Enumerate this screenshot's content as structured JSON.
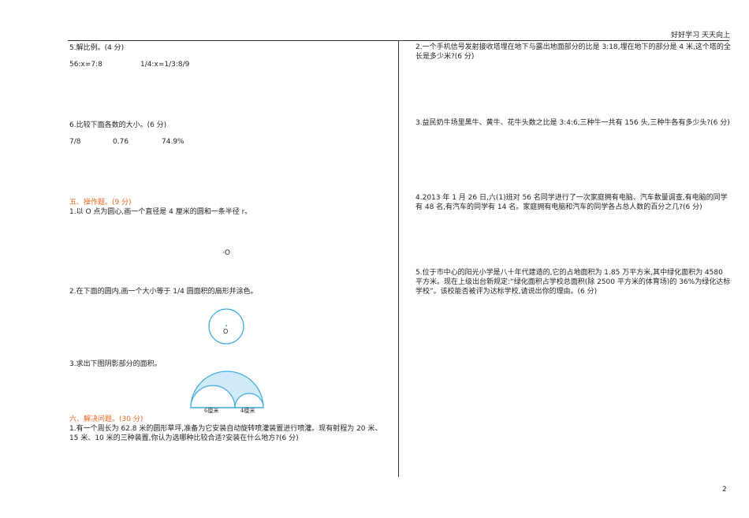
{
  "header": {
    "slogan": "好好学习 天天向上"
  },
  "page_number": "2",
  "left": {
    "q5": {
      "title": "5.解比例。(4 分)",
      "eq1": "56:x=7:8",
      "eq2": "1/4:x=1/3:8/9"
    },
    "q6": {
      "title": "6.比较下面各数的大小。(6 分)",
      "n1": "7/8",
      "n2": "0.76",
      "n3": "74.9%"
    },
    "section5": {
      "title": "五、操作题。(9 分)",
      "q1": "1.以 O 点为圆心,画一个直径是 4 厘米的圆和一条半径 r。",
      "point_label": "·O",
      "q2": "2.在下面的圆内,画一个大小等于 1/4 圆面积的扇形并涂色。",
      "circle_label": "O",
      "q3": "3.求出下图阴影部分的面积。",
      "fig_label1": "6厘米",
      "fig_label2": "4厘米"
    },
    "section6": {
      "title": "六、解决问题。(30 分)",
      "q1": "1.有一个周长为 62.8 米的圆形草坪,准备为它安装自动旋转喷灌装置进行喷灌。现有射程为 20 米、15 米、10 米的三种装置,你认为选哪种比较合适?安装在什么地方?(6 分)"
    }
  },
  "right": {
    "q2": "2.一个手机信号发射接收塔埋在地下与露出地面部分的比是 3:18,埋在地下的部分是 4 米,这个塔的全长是多少米?(6 分)",
    "q3": "3.益民奶牛场里黑牛、黄牛、花牛头数之比是 3:4:6,三种牛一共有 156 头,三种牛各有多少头?(6 分)",
    "q4": "4.2013 年 1 月 26 日,六(1)班对 56 名同学进行了一次家庭拥有电脑、汽车数量调查,有电脑的同学有 48 名,有汽车的同学有 14 名。家庭拥有电脑和汽车的同学各占总人数的百分之几?(6 分)",
    "q5": "5.位于市中心的阳光小学是八十年代建造的,它的占地面积为 1.85 万平方米,其中绿化面积为 4580 平方米。现在上级出台新规定:“绿化面积占学校总面积(除 2500 平方米的体育场)的 36%为绿化达标学校”。该校能否被评为达标学校,请说出你的理由。(6 分)"
  },
  "colors": {
    "accent": "#e8641d",
    "figure_stroke": "#3fa9df",
    "figure_fill": "#cfe9f7"
  }
}
